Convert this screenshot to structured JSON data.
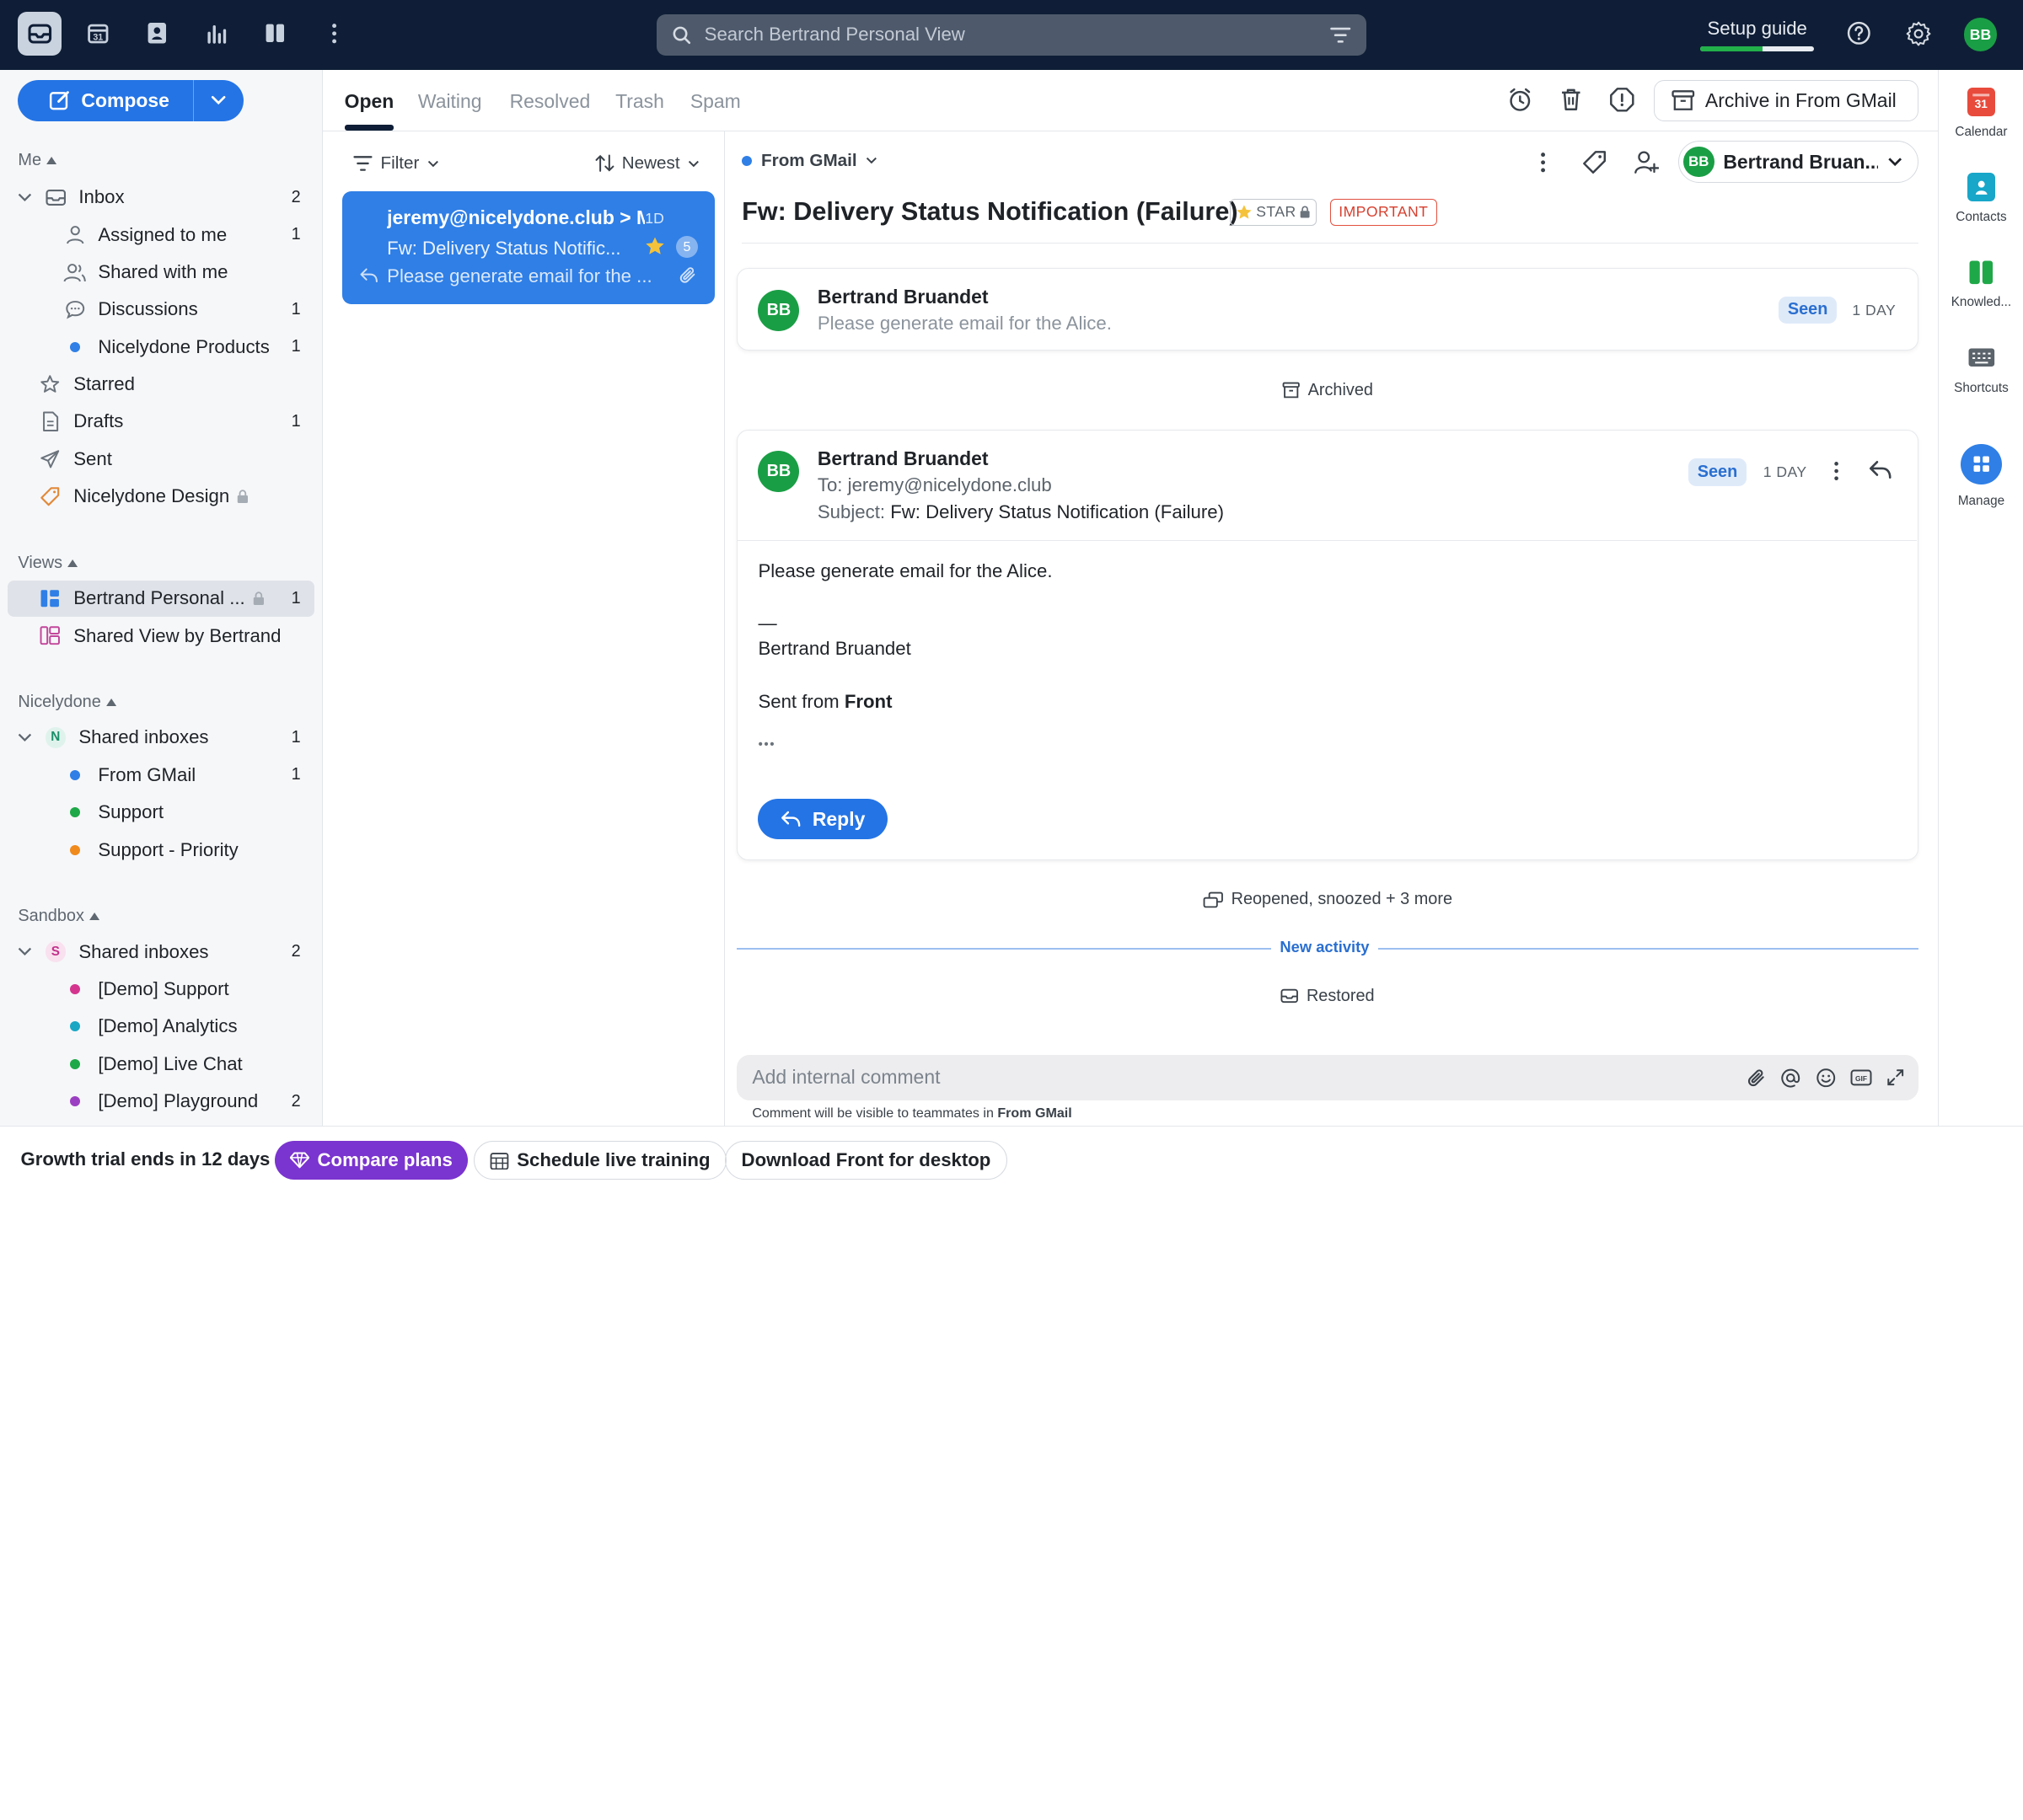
{
  "search": {
    "placeholder": "Search Bertrand Personal View"
  },
  "topbar": {
    "setup_label": "Setup guide",
    "setup_progress": 0.55,
    "avatar": "BB"
  },
  "compose": {
    "label": "Compose"
  },
  "sidebar": {
    "me_section": "Me",
    "inbox": {
      "label": "Inbox",
      "count": "2"
    },
    "inbox_items": [
      {
        "label": "Assigned to me",
        "count": "1"
      },
      {
        "label": "Shared with me",
        "count": ""
      },
      {
        "label": "Discussions",
        "count": "1"
      },
      {
        "label": "Nicelydone Products",
        "count": "1"
      }
    ],
    "top_items": [
      {
        "label": "Starred",
        "count": ""
      },
      {
        "label": "Drafts",
        "count": "1"
      },
      {
        "label": "Sent",
        "count": ""
      },
      {
        "label": "Nicelydone Design",
        "count": ""
      }
    ],
    "views_section": "Views",
    "views": [
      {
        "label": "Bertrand Personal ...",
        "count": "1"
      },
      {
        "label": "Shared View by Bertrand",
        "count": ""
      }
    ],
    "nicelydone_section": "Nicelydone",
    "nicelydone_shared": {
      "label": "Shared inboxes",
      "badge": "N",
      "count": "1"
    },
    "nicelydone_inboxes": [
      {
        "label": "From GMail",
        "count": "1",
        "color": "#2f7fe6"
      },
      {
        "label": "Support",
        "count": "",
        "color": "#1fa848"
      },
      {
        "label": "Support - Priority",
        "count": "",
        "color": "#f08a1c"
      }
    ],
    "sandbox_section": "Sandbox",
    "sandbox_shared": {
      "label": "Shared inboxes",
      "badge": "S",
      "count": "2"
    },
    "sandbox_inboxes": [
      {
        "label": "[Demo] Support",
        "count": "",
        "color": "#d4358f"
      },
      {
        "label": "[Demo] Analytics",
        "count": "",
        "color": "#1aa7c4"
      },
      {
        "label": "[Demo] Live Chat",
        "count": "",
        "color": "#1fa848"
      },
      {
        "label": "[Demo] Playground",
        "count": "2",
        "color": "#9b3fc2"
      }
    ]
  },
  "tabs": [
    "Open",
    "Waiting",
    "Resolved",
    "Trash",
    "Spam"
  ],
  "actions": {
    "archive": "Archive in From GMail"
  },
  "list": {
    "filter": "Filter",
    "sort": "Newest",
    "card": {
      "from": "jeremy@nicelydone.club",
      "arrow_to": "> M",
      "age": "1D",
      "subject": "Fw: Delivery Status Notific...",
      "count": "5",
      "preview": "Please generate email for the ..."
    }
  },
  "conversation": {
    "inbox": "From GMail",
    "assignee": "Bertrand Bruan...",
    "assignee_avatar": "BB",
    "title": "Fw: Delivery Status Notification (Failure)",
    "tags": {
      "star": "STAR",
      "important": "IMPORTANT"
    },
    "msg1": {
      "avatar": "BB",
      "name": "Bertrand Bruandet",
      "preview": "Please generate email for the Alice.",
      "status": "Seen",
      "age": "1 DAY"
    },
    "event_archived": "Archived",
    "msg2": {
      "avatar": "BB",
      "name": "Bertrand Bruandet",
      "to_label": "To:",
      "to": "jeremy@nicelydone.club",
      "subject_label": "Subject:",
      "subject": "Fw: Delivery Status Notification (Failure)",
      "status": "Seen",
      "age": "1 DAY",
      "body_line1": "Please generate email for the Alice.",
      "sig_dash": "—",
      "sig_name": "Bertrand Bruandet",
      "sent_from": "Sent from",
      "sent_from_app": "Front",
      "more": "•••",
      "reply": "Reply"
    },
    "event_reopened": "Reopened, snoozed + 3 more",
    "new_activity": "New activity",
    "event_restored": "Restored",
    "comment_placeholder": "Add internal comment",
    "comment_note": "Comment will be visible to teammates in",
    "comment_note_inbox": "From GMail"
  },
  "rightrail": [
    {
      "label": "Calendar",
      "icon": "calendar-icon"
    },
    {
      "label": "Contacts",
      "icon": "contacts-icon"
    },
    {
      "label": "Knowled...",
      "icon": "knowledge-icon"
    },
    {
      "label": "Shortcuts",
      "icon": "keyboard-icon"
    },
    {
      "label": "Manage",
      "icon": "manage-icon"
    }
  ],
  "footer": {
    "trial": "Growth trial ends in 12 days",
    "compare": "Compare plans",
    "schedule": "Schedule live training",
    "download": "Download Front for desktop"
  }
}
